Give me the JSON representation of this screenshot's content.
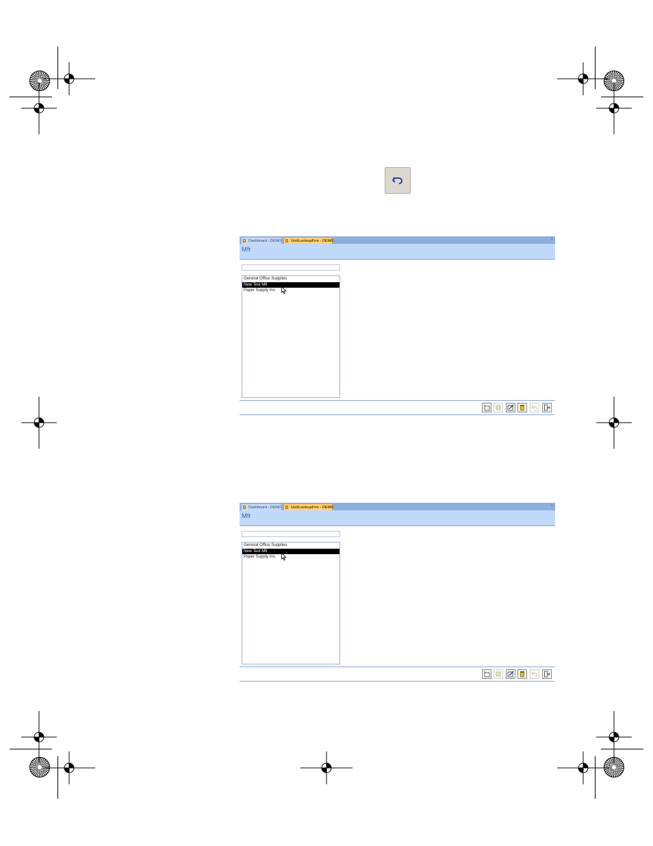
{
  "undo_button": {
    "icon": "undo-icon"
  },
  "screens": [
    {
      "tabs": [
        {
          "label": "Dashboard - DEMO",
          "active": false
        },
        {
          "label": "UnitLookupFrm - DEMO",
          "active": true
        }
      ],
      "close_glyph": "×",
      "title": "Mfr",
      "search_value": "",
      "list_items": [
        "General Office Supplies",
        "New Test Mfr",
        "Paper Supply Inc."
      ],
      "selected_index": 1,
      "toolbar": [
        "new-record-icon",
        "save-icon",
        "edit-icon",
        "delete-icon",
        "undo-icon",
        "exit-icon"
      ]
    },
    {
      "tabs": [
        {
          "label": "Dashboard - DEMO",
          "active": false
        },
        {
          "label": "UnitLookupFrm - DEMO",
          "active": true
        }
      ],
      "close_glyph": "×",
      "title": "Mfr",
      "search_value": "",
      "list_items": [
        "General Office Supplies",
        "New Test Mfr",
        "Paper Supply Inc."
      ],
      "selected_index": 1,
      "toolbar": [
        "new-record-icon",
        "save-icon",
        "edit-icon",
        "delete-icon",
        "undo-icon",
        "exit-icon"
      ]
    }
  ]
}
